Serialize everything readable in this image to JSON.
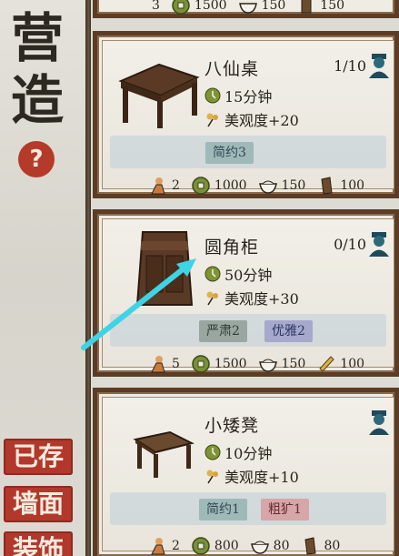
{
  "sidebar": {
    "title_top": "营",
    "title_bottom": "造",
    "help": "?",
    "tabs": [
      "已存",
      "墙面",
      "装饰"
    ]
  },
  "top_partial": {
    "costs": [
      "3",
      "1500",
      "150",
      "150"
    ]
  },
  "cards": [
    {
      "name": "八仙桌",
      "count": "1/10",
      "time": "15分钟",
      "beauty": "美观度+20",
      "tags": [
        {
          "label": "简约3",
          "style": "green"
        }
      ],
      "costs": [
        {
          "icon": "worker-icon",
          "value": "2"
        },
        {
          "icon": "coin-icon",
          "value": "1000"
        },
        {
          "icon": "bowl-icon",
          "value": "150"
        },
        {
          "icon": "wood-icon",
          "value": "100"
        }
      ]
    },
    {
      "name": "圆角柜",
      "count": "0/10",
      "time": "50分钟",
      "beauty": "美观度+30",
      "tags": [
        {
          "label": "严肃2",
          "style": "gray"
        },
        {
          "label": "优雅2",
          "style": "purple"
        }
      ],
      "costs": [
        {
          "icon": "worker-icon",
          "value": "5"
        },
        {
          "icon": "coin-icon",
          "value": "1500"
        },
        {
          "icon": "bowl-icon",
          "value": "150"
        },
        {
          "icon": "plank-icon",
          "value": "100"
        }
      ]
    },
    {
      "name": "小矮凳",
      "count": "",
      "time": "10分钟",
      "beauty": "美观度+10",
      "tags": [
        {
          "label": "简约1",
          "style": "green"
        },
        {
          "label": "粗犷1",
          "style": "pink"
        }
      ],
      "costs": [
        {
          "icon": "worker-icon",
          "value": "2"
        },
        {
          "icon": "coin-icon",
          "value": "800"
        },
        {
          "icon": "bowl-icon",
          "value": "80"
        },
        {
          "icon": "wood-icon",
          "value": "80"
        }
      ]
    }
  ],
  "colors": {
    "accent_red": "#b2382b",
    "frame_brown": "#5b3d27",
    "arrow_cyan": "#3fd3e6"
  }
}
